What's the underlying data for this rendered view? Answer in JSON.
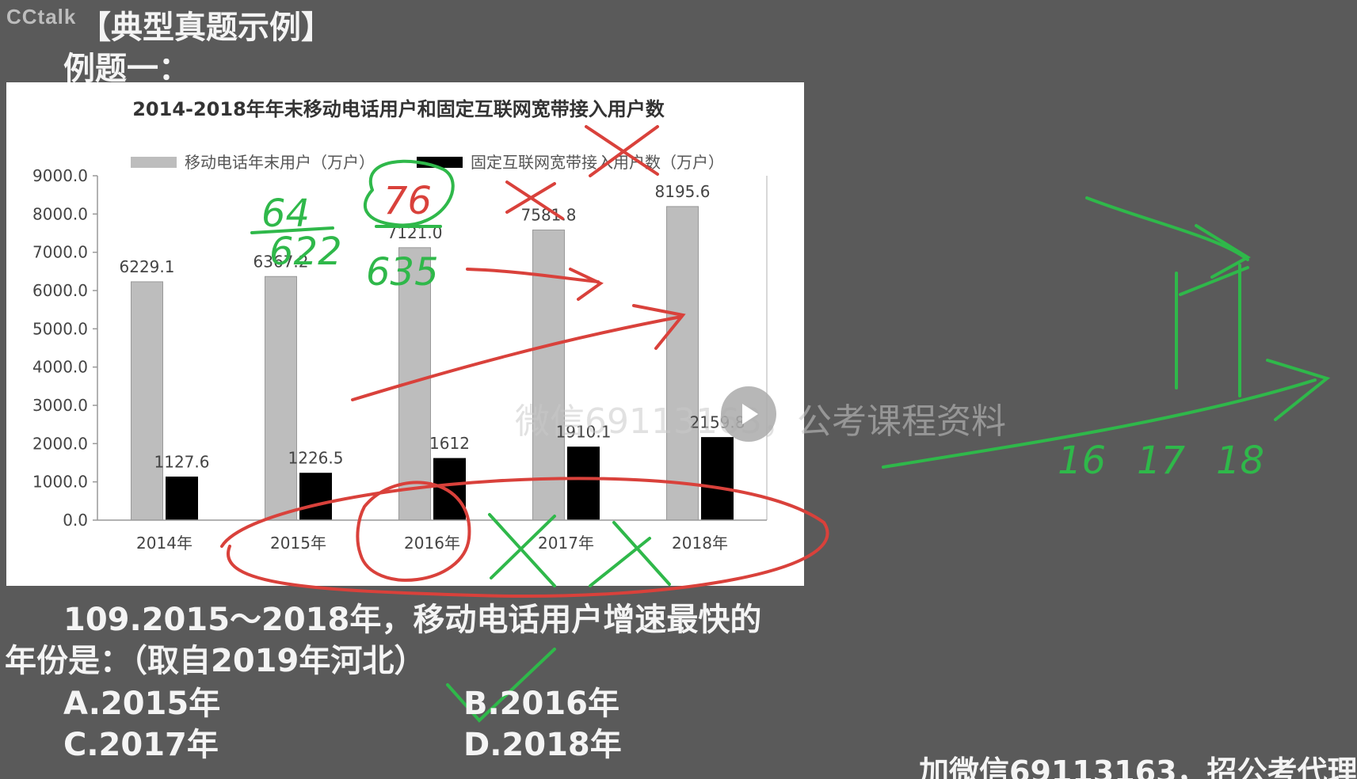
{
  "logo": "CCtalk",
  "slide_title": "【典型真题示例】",
  "example_label": "例题一：",
  "chart_data": {
    "type": "bar",
    "title": "2014-2018年年末移动电话用户和固定互联网宽带接入用户数",
    "categories": [
      "2014年",
      "2015年",
      "2016年",
      "2017年",
      "2018年"
    ],
    "series": [
      {
        "name": "移动电话年末用户（万户）",
        "values": [
          6229.1,
          6367.2,
          7121.0,
          7581.8,
          8195.6
        ],
        "labels": [
          "6229.1",
          "6367.2",
          "7121.0",
          "7581.8",
          "8195.6"
        ],
        "color": "#bdbdbd"
      },
      {
        "name": "固定互联网宽带接入用户数（万户）",
        "values": [
          1127.6,
          1226.5,
          1612,
          1910.1,
          2159.8
        ],
        "labels": [
          "1127.6",
          "1226.5",
          "1612",
          "1910.1",
          "2159.8"
        ],
        "color": "#000000"
      }
    ],
    "ylim": [
      0,
      9000
    ],
    "yticks": [
      "0.0",
      "1000.0",
      "2000.0",
      "3000.0",
      "4000.0",
      "5000.0",
      "6000.0",
      "7000.0",
      "8000.0",
      "9000.0"
    ],
    "xlabel": "",
    "ylabel": "",
    "legend_position": "top",
    "grid": false
  },
  "annotations": {
    "handwritten_numbers": [
      "64",
      "622",
      "76",
      "635",
      "16",
      "17",
      "18"
    ]
  },
  "question": {
    "line1": "109.2015～2018年，移动电话用户增速最快的",
    "line2": "年份是：（取自2019年河北）",
    "options": {
      "a": "A.2015年",
      "b": "B.2016年",
      "c": "C.2017年",
      "d": "D.2018年"
    }
  },
  "watermark": "微信69113163，公考课程资料",
  "bottom_banner": "加微信69113163，招公考代理"
}
